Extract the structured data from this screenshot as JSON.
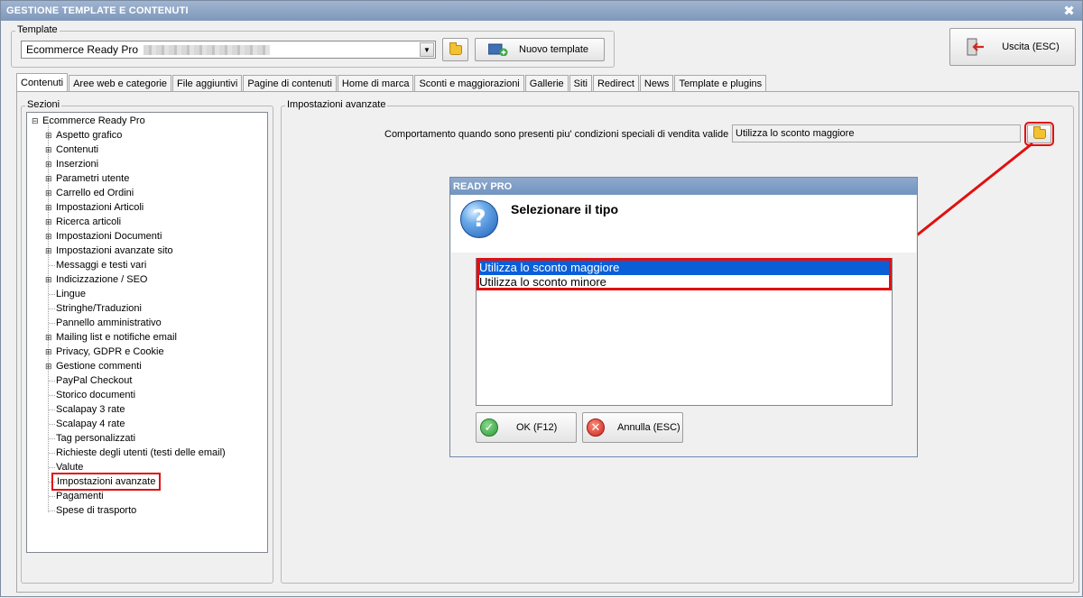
{
  "window": {
    "title": "GESTIONE TEMPLATE E CONTENUTI",
    "close_glyph": "✖"
  },
  "template_group": {
    "label": "Template",
    "combo_value": "Ecommerce Ready Pro",
    "new_template_label": "Nuovo template"
  },
  "exit_button": {
    "label": "Uscita (ESC)"
  },
  "tabs": [
    "Contenuti",
    "Aree web e categorie",
    "File aggiuntivi",
    "Pagine di contenuti",
    "Home di marca",
    "Sconti e maggiorazioni",
    "Gallerie",
    "Siti",
    "Redirect",
    "News",
    "Template e plugins"
  ],
  "sections": {
    "label": "Sezioni",
    "root": "Ecommerce Ready Pro",
    "root_toggle": "⊟",
    "expand_glyph": "⊞",
    "items": [
      {
        "label": "Aspetto grafico",
        "expandable": true
      },
      {
        "label": "Contenuti",
        "expandable": true
      },
      {
        "label": "Inserzioni",
        "expandable": true
      },
      {
        "label": "Parametri utente",
        "expandable": true
      },
      {
        "label": "Carrello ed Ordini",
        "expandable": true
      },
      {
        "label": "Impostazioni Articoli",
        "expandable": true
      },
      {
        "label": "Ricerca articoli",
        "expandable": true
      },
      {
        "label": "Impostazioni Documenti",
        "expandable": true
      },
      {
        "label": "Impostazioni avanzate sito",
        "expandable": true
      },
      {
        "label": "Messaggi e testi vari",
        "expandable": false
      },
      {
        "label": "Indicizzazione / SEO",
        "expandable": true
      },
      {
        "label": "Lingue",
        "expandable": false
      },
      {
        "label": "Stringhe/Traduzioni",
        "expandable": false
      },
      {
        "label": "Pannello amministrativo",
        "expandable": false
      },
      {
        "label": "Mailing list e notifiche email",
        "expandable": true
      },
      {
        "label": "Privacy, GDPR e Cookie",
        "expandable": true
      },
      {
        "label": "Gestione commenti",
        "expandable": true
      },
      {
        "label": "PayPal Checkout",
        "expandable": false
      },
      {
        "label": "Storico documenti",
        "expandable": false
      },
      {
        "label": "Scalapay 3 rate",
        "expandable": false
      },
      {
        "label": "Scalapay 4 rate",
        "expandable": false
      },
      {
        "label": "Tag personalizzati",
        "expandable": false
      },
      {
        "label": "Richieste degli utenti (testi delle email)",
        "expandable": false
      },
      {
        "label": "Valute",
        "expandable": false
      },
      {
        "label": "Impostazioni avanzate",
        "expandable": false,
        "selected": true
      },
      {
        "label": "Pagamenti",
        "expandable": false
      },
      {
        "label": "Spese di trasporto",
        "expandable": false
      }
    ]
  },
  "advanced": {
    "group_label": "Impostazioni avanzate",
    "field_label": "Comportamento quando sono presenti piu' condizioni speciali di vendita valide :",
    "field_value": "Utilizza lo sconto maggiore"
  },
  "dialog": {
    "title": "READY PRO",
    "icon_glyph": "?",
    "heading": "Selezionare il tipo",
    "options": [
      "Utilizza lo sconto maggiore",
      "Utilizza lo sconto minore"
    ],
    "selected_index": 0,
    "ok_label": "OK (F12)",
    "ok_glyph": "✓",
    "cancel_label": "Annulla (ESC)",
    "cancel_glyph": "✕"
  },
  "colors": {
    "annotation_red": "#e01010",
    "selection_blue": "#0a5fd8"
  }
}
